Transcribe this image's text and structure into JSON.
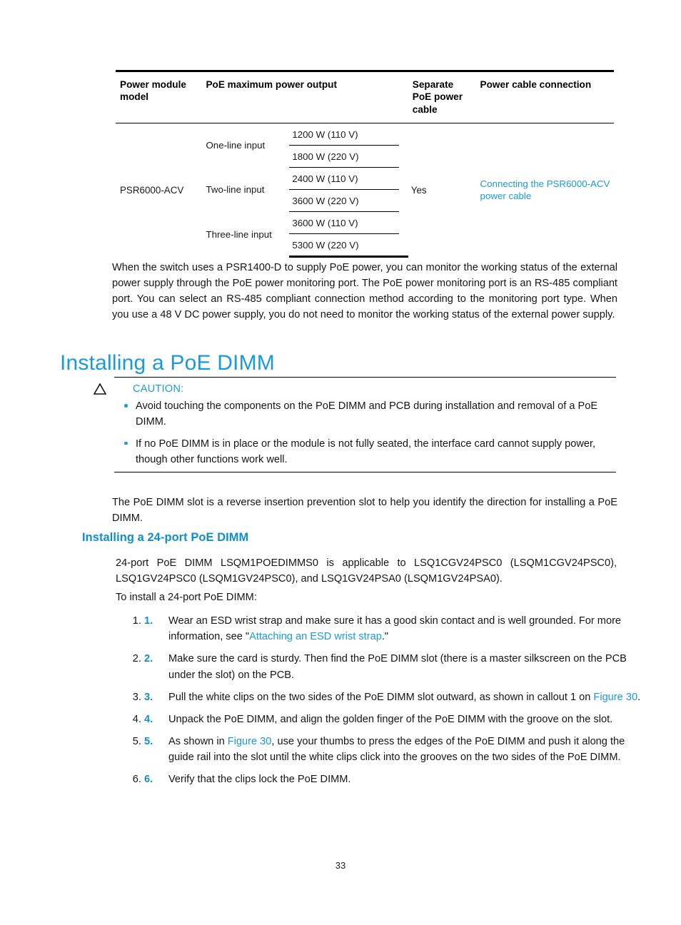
{
  "colors": {
    "link": "#1a9ad7",
    "heading": "#1a9ad7",
    "subheading": "#0e8fcc",
    "bullet": "#1a9ad7",
    "text": "#151515"
  },
  "table": {
    "headers": {
      "model": "Power module model",
      "output": "PoE maximum power output",
      "separate_cable": "Separate PoE power cable",
      "connection": "Power cable connection"
    },
    "model": "PSR6000-ACV",
    "separate_cable_value": "Yes",
    "connection_link": "Connecting the PSR6000-ACV power cable",
    "groups": [
      {
        "label": "One-line input",
        "values": [
          "1200 W (110 V)",
          "1800 W (220 V)"
        ]
      },
      {
        "label": "Two-line input",
        "values": [
          "2400 W (110 V)",
          "3600 W (220 V)"
        ]
      },
      {
        "label": "Three-line input",
        "values": [
          "3600 W (110 V)",
          "5300 W (220 V)"
        ]
      }
    ]
  },
  "intro_paragraph": "When the switch uses a PSR1400-D to supply PoE power, you can monitor the working status of the external power supply through the PoE power monitoring port. The PoE power monitoring port is an RS-485 compliant port. You can select an RS-485 compliant connection method according to the monitoring port type. When you use a 48 V DC power supply, you do not need to monitor the working status of the external power supply.",
  "heading1": "Installing a PoE DIMM",
  "caution": {
    "label": "CAUTION:",
    "icon": "warning-triangle-icon",
    "items": [
      "Avoid touching the components on the PoE DIMM and PCB during installation and removal of a PoE DIMM.",
      "If no PoE DIMM is in place or the module is not fully seated, the interface card cannot supply power, though other functions work well."
    ]
  },
  "slot_paragraph": "The PoE DIMM slot is a reverse insertion prevention slot to help you identify the direction for installing a PoE DIMM.",
  "heading2": "Installing a 24-port PoE DIMM",
  "applicability_paragraph": "24-port PoE DIMM LSQM1POEDIMMS0 is applicable to LSQ1CGV24PSC0 (LSQM1CGV24PSC0), LSQ1GV24PSC0 (LSQM1GV24PSC0), and LSQ1GV24PSA0 (LSQM1GV24PSA0).",
  "to_install_paragraph": "To install a 24-port PoE DIMM:",
  "steps": [
    {
      "number": "1.",
      "parts": [
        {
          "t": "Wear an ESD wrist strap and make sure it has a good skin contact and is well grounded. For more information, see \"",
          "link": false
        },
        {
          "t": "Attaching an ESD wrist strap",
          "link": true
        },
        {
          "t": ".\"",
          "link": false
        }
      ]
    },
    {
      "number": "2.",
      "parts": [
        {
          "t": "Make sure the card is sturdy. Then find the PoE DIMM slot (there is a master silkscreen on the PCB under the slot) on the PCB.",
          "link": false
        }
      ]
    },
    {
      "number": "3.",
      "parts": [
        {
          "t": "Pull the white clips on the two sides of the PoE DIMM slot outward, as shown in callout 1 on ",
          "link": false
        },
        {
          "t": "Figure 30",
          "link": true
        },
        {
          "t": ".",
          "link": false
        }
      ]
    },
    {
      "number": "4.",
      "parts": [
        {
          "t": "Unpack the PoE DIMM, and align the golden finger of the PoE DIMM with the groove on the slot.",
          "link": false
        }
      ]
    },
    {
      "number": "5.",
      "parts": [
        {
          "t": "As shown in ",
          "link": false
        },
        {
          "t": "Figure 30",
          "link": true
        },
        {
          "t": ", use your thumbs to press the edges of the PoE DIMM and push it along the guide rail into the slot until the white clips click into the grooves on the two sides of the PoE DIMM.",
          "link": false
        }
      ]
    },
    {
      "number": "6.",
      "parts": [
        {
          "t": "Verify that the clips lock the PoE DIMM.",
          "link": false
        }
      ]
    }
  ],
  "page_number": "33"
}
